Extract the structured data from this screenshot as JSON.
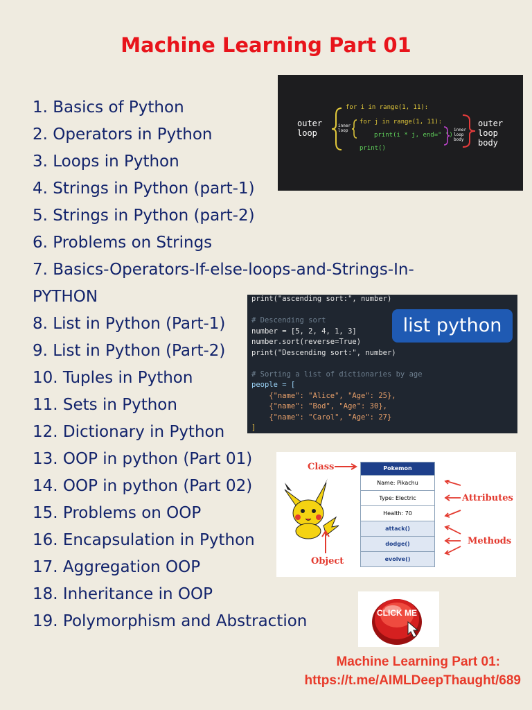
{
  "title": "Machine Learning Part 01",
  "items": [
    "1. Basics of Python",
    "2. Operators in Python",
    "3. Loops in Python",
    "4. Strings in Python (part-1)",
    "5. Strings in Python (part-2)",
    "6. Problems on Strings",
    "7. Basics-Operators-If-else-loops-and-Strings-In-PYTHON",
    "8. List in Python (Part-1)",
    "9. List in Python (Part-2)",
    "10. Tuples in Python",
    "11. Sets in Python",
    "12. Dictionary in Python",
    "13. OOP in python (Part 01)",
    "14. OOP in python (Part 02)",
    "15. Problems on OOP",
    "16. Encapsulation in Python",
    "17. Aggregation OOP",
    "18. Inheritance in OOP",
    "19. Polymorphism and Abstraction"
  ],
  "loops_image": {
    "outer_label": "outer\nloop",
    "inner_label": "inner\nloop",
    "body_label": "inner\nloop\nbody",
    "outer_body_label": "outer\nloop\nbody",
    "line1": "for i in range(1, 11):",
    "line2": "for j in range(1, 11):",
    "line3": "print(i * j, end=\" \")",
    "line4": "print()"
  },
  "list_image": {
    "badge": "list python",
    "lines": [
      "print(\"ascending sort:\", number)",
      "",
      "# Descending sort",
      "number = [5, 2, 4, 1, 3]",
      "number.sort(reverse=True)",
      "print(\"Descending sort:\", number)",
      "",
      "# Sorting a list of dictionaries by age",
      "people = [",
      "    {\"name\": \"Alice\", \"Age\": 25},",
      "    {\"name\": \"Bod\", \"Age\": 30},",
      "    {\"name\": \"Carol\", \"Age\": 27}",
      "]"
    ]
  },
  "oop_image": {
    "class_label": "Class",
    "object_label": "Object",
    "attributes_label": "Attributes",
    "methods_label": "Methods",
    "header": "Pokemon",
    "attributes": [
      "Name: Pikachu",
      "Type: Electric",
      "Health: 70"
    ],
    "methods": [
      "attack()",
      "dodge()",
      "evolve()"
    ]
  },
  "click_button": "CLICK ME",
  "footer_line1": "Machine Learning Part 01:",
  "footer_line2": "https://t.me/AIMLDeepThaught/689"
}
